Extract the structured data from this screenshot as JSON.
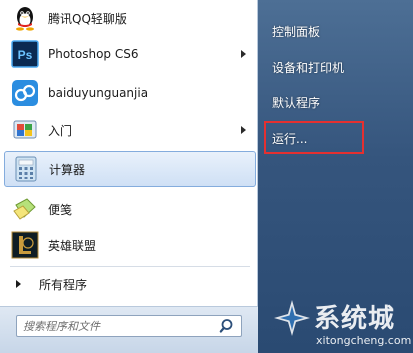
{
  "programs": [
    {
      "label": "腾讯QQ轻聊版",
      "icon": "qq-penguin-icon",
      "has_submenu": false
    },
    {
      "label": "Photoshop CS6",
      "icon": "photoshop-icon",
      "has_submenu": true
    },
    {
      "label": "baiduyunguanjia",
      "icon": "baidu-cloud-icon",
      "has_submenu": false
    },
    {
      "label": "入门",
      "icon": "getting-started-icon",
      "has_submenu": true
    },
    {
      "label": "计算器",
      "icon": "calculator-icon",
      "has_submenu": false,
      "selected": true
    },
    {
      "label": "便笺",
      "icon": "sticky-notes-icon",
      "has_submenu": false
    },
    {
      "label": "英雄联盟",
      "icon": "league-of-legends-icon",
      "has_submenu": false
    }
  ],
  "all_programs": "所有程序",
  "search": {
    "placeholder": "搜索程序和文件"
  },
  "right_items": [
    "控制面板",
    "设备和打印机",
    "默认程序",
    "运行..."
  ],
  "watermark": {
    "brand": "系统城",
    "domain": "xitongcheng.com"
  },
  "colors": {
    "highlight_border": "#e53030",
    "right_pane": "#35557d",
    "selection": "#cfe0f5"
  }
}
